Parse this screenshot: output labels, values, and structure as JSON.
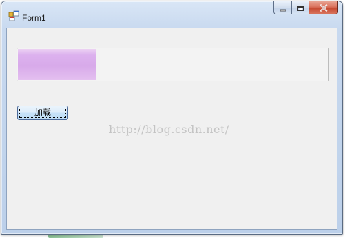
{
  "window": {
    "title": "Form1"
  },
  "caption_buttons": {
    "minimize_icon": "minimize-icon",
    "restore_icon": "restore-icon",
    "close_icon": "close-icon"
  },
  "progress_bar": {
    "value_fraction": 0.25,
    "fill_color": "#d8aaea"
  },
  "load_button": {
    "label": "加载"
  },
  "watermark": {
    "text": "http://blog.csdn.net/"
  },
  "colors": {
    "client_background": "#f0f0f0",
    "close_button": "#c64a32"
  }
}
